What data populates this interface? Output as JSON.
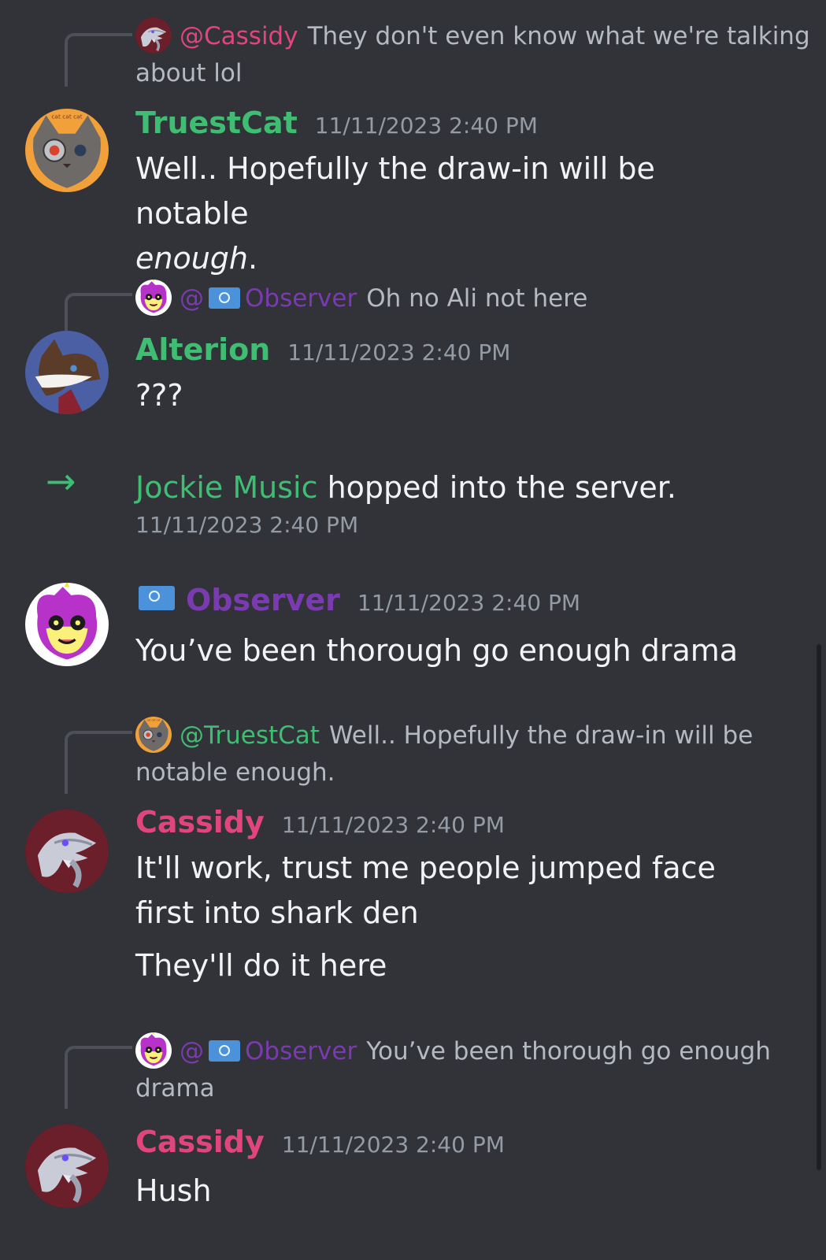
{
  "colors": {
    "background": "#313338",
    "green_name": "#3fbd73",
    "pink_name": "#e0457b",
    "purple_name": "#7b3bb0",
    "timestamp": "#949ba4"
  },
  "messages": {
    "m1": {
      "reply": {
        "mention": "@Cassidy",
        "text": "They don't even know what we're talking about lol",
        "avatar_icon": "cassidy-avatar-icon"
      },
      "author": "TruestCat",
      "timestamp": "11/11/2023 2:40 PM",
      "text_main": "Well.. Hopefully the draw-in will be notable",
      "text_italic": "enough",
      "text_end": ".",
      "avatar_icon": "truestcat-avatar-icon"
    },
    "m2": {
      "reply": {
        "mention_prefix": "@",
        "mention_name": "Observer",
        "text": "Oh no Ali not here",
        "avatar_icon": "observer-avatar-icon",
        "flag_icon": "un-flag-icon"
      },
      "author": "Alterion",
      "timestamp": "11/11/2023 2:40 PM",
      "text": "???",
      "avatar_icon": "alterion-avatar-icon"
    },
    "join": {
      "arrow": "→",
      "name": "Jockie Music",
      "text": " hopped into the server.",
      "timestamp": "11/11/2023 2:40 PM"
    },
    "m3": {
      "author": "Observer",
      "timestamp": "11/11/2023 2:40 PM",
      "text": "You’ve been thorough go enough drama",
      "avatar_icon": "observer-avatar-icon",
      "flag_icon": "un-flag-icon"
    },
    "m4": {
      "reply": {
        "mention": "@TruestCat",
        "text": "Well.. Hopefully the draw-in will be notable enough.",
        "avatar_icon": "truestcat-avatar-icon"
      },
      "author": "Cassidy",
      "timestamp": "11/11/2023 2:40 PM",
      "text_1": "It'll work, trust me people jumped face first into shark den",
      "text_2": "They'll do it here",
      "avatar_icon": "cassidy-avatar-icon"
    },
    "m5": {
      "reply": {
        "mention_prefix": "@",
        "mention_name": "Observer",
        "text": "You’ve been thorough go enough drama",
        "avatar_icon": "observer-avatar-icon",
        "flag_icon": "un-flag-icon"
      },
      "author": "Cassidy",
      "timestamp": "11/11/2023 2:40 PM",
      "text": "Hush",
      "avatar_icon": "cassidy-avatar-icon"
    }
  }
}
